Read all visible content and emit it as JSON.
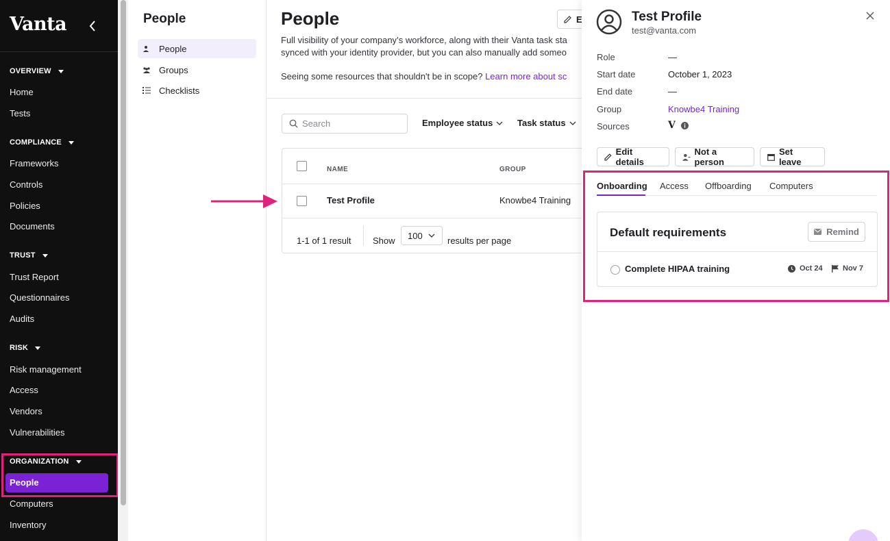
{
  "sidebar": {
    "logo": "Vanta",
    "sections": [
      {
        "title": "OVERVIEW",
        "items": [
          "Home",
          "Tests"
        ]
      },
      {
        "title": "COMPLIANCE",
        "items": [
          "Frameworks",
          "Controls",
          "Policies",
          "Documents"
        ]
      },
      {
        "title": "TRUST",
        "items": [
          "Trust Report",
          "Questionnaires",
          "Audits"
        ]
      },
      {
        "title": "RISK",
        "items": [
          "Risk management",
          "Access",
          "Vendors",
          "Vulnerabilities"
        ]
      },
      {
        "title": "ORGANIZATION",
        "items": [
          "People",
          "Computers",
          "Inventory"
        ]
      }
    ],
    "active_item": "People"
  },
  "subnav": {
    "title": "People",
    "items": [
      "People",
      "Groups",
      "Checklists"
    ]
  },
  "main": {
    "title": "People",
    "edit_button_partial": "E",
    "description_line1": "Full visibility of your company’s workforce, along with their Vanta task sta",
    "description_line2": "synced with your identity provider, but you can also manually add someo",
    "scope_text": "Seeing some resources that shouldn't be in scope?",
    "scope_link": "Learn more about sc",
    "search_placeholder": "Search",
    "filters": [
      "Employee status",
      "Task status"
    ],
    "table": {
      "columns": [
        "NAME",
        "GROUP"
      ],
      "rows": [
        {
          "name": "Test Profile",
          "group": "Knowbe4 Training"
        }
      ],
      "result_count": "1-1 of 1 result",
      "show_label": "Show",
      "per_page": "100",
      "per_page_suffix": "results per page"
    }
  },
  "drawer": {
    "name": "Test Profile",
    "email": "test@vanta.com",
    "properties": [
      {
        "label": "Role",
        "value": "—"
      },
      {
        "label": "Start date",
        "value": "October 1, 2023"
      },
      {
        "label": "End date",
        "value": "—"
      },
      {
        "label": "Group",
        "value": "Knowbe4 Training"
      },
      {
        "label": "Sources",
        "value": "V"
      }
    ],
    "buttons": [
      "Edit details",
      "Not a person",
      "Set leave"
    ],
    "tabs": [
      "Onboarding",
      "Access",
      "Offboarding",
      "Computers"
    ],
    "active_tab": "Onboarding",
    "requirements": {
      "title": "Default requirements",
      "remind_label": "Remind",
      "tasks": [
        {
          "label": "Complete HIPAA training",
          "start": "Oct 24",
          "due": "Nov 7"
        }
      ]
    }
  },
  "colors": {
    "accent": "#7b22d6",
    "highlight": "#e0237a",
    "sidebar_bg": "#101010"
  }
}
